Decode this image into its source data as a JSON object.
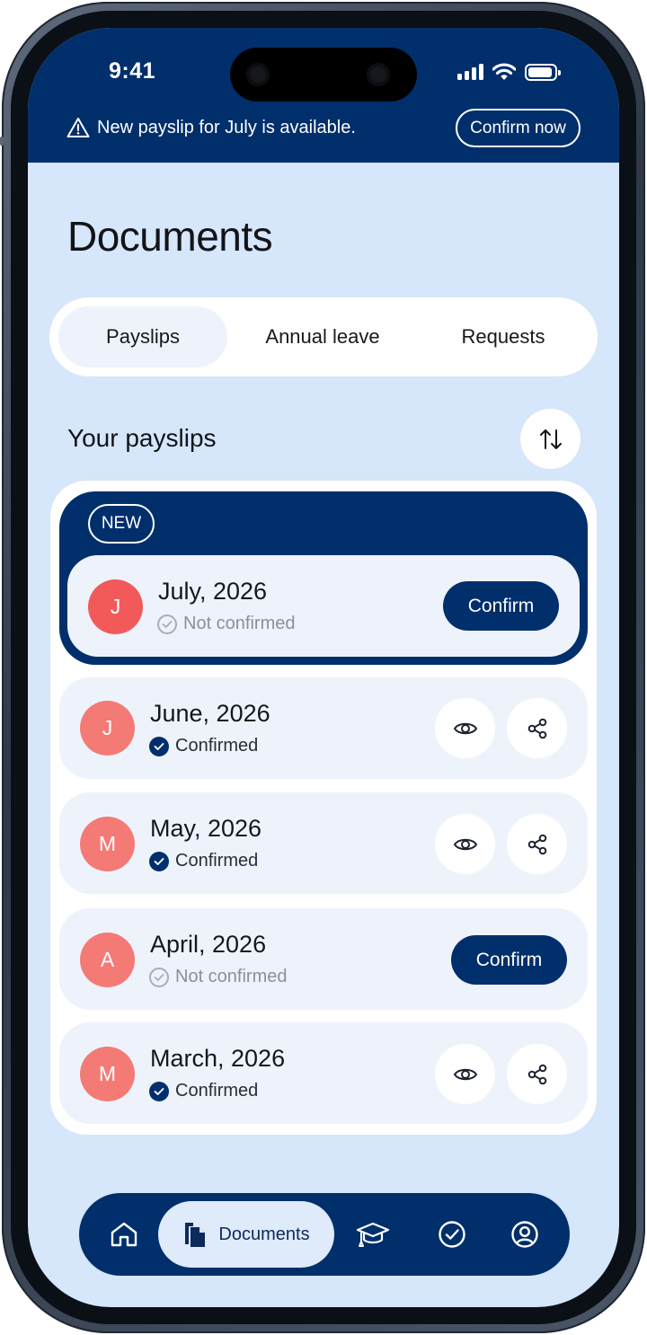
{
  "status_bar": {
    "time": "9:41"
  },
  "banner": {
    "icon": "warning-icon",
    "message": "New payslip for July is available.",
    "action_label": "Confirm now"
  },
  "page": {
    "title": "Documents"
  },
  "tabs": [
    {
      "label": "Payslips",
      "active": true
    },
    {
      "label": "Annual leave",
      "active": false
    },
    {
      "label": "Requests",
      "active": false
    }
  ],
  "section": {
    "title": "Your payslips",
    "sort_icon": "sort-arrows-icon"
  },
  "new_badge": "NEW",
  "payslips": [
    {
      "initial": "J",
      "month": "July, 2026",
      "status": "Not confirmed",
      "confirmed": false,
      "action": "Confirm"
    },
    {
      "initial": "J",
      "month": "June, 2026",
      "status": "Confirmed",
      "confirmed": true
    },
    {
      "initial": "M",
      "month": "May, 2026",
      "status": "Confirmed",
      "confirmed": true
    },
    {
      "initial": "A",
      "month": "April, 2026",
      "status": "Not confirmed",
      "confirmed": false,
      "action": "Confirm"
    },
    {
      "initial": "M",
      "month": "March, 2026",
      "status": "Confirmed",
      "confirmed": true
    }
  ],
  "bottom_nav": {
    "items": [
      "home-icon",
      "documents-icon",
      "graduation-cap-icon",
      "check-circle-icon",
      "profile-icon"
    ],
    "active_label": "Documents"
  },
  "colors": {
    "brand_navy": "#002f6c",
    "background": "#d6e6fb",
    "avatar_new": "#f25a5a",
    "avatar": "#f47a76",
    "row_bg": "#eef3fb"
  }
}
